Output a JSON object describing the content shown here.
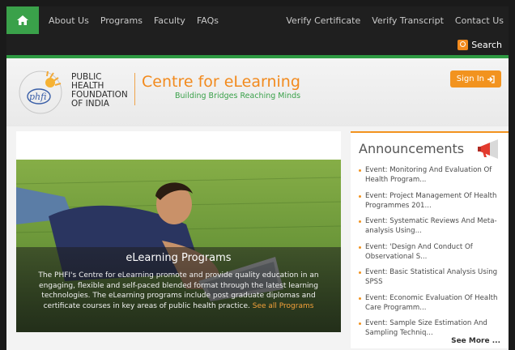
{
  "nav": {
    "links_left": [
      "About Us",
      "Programs",
      "Faculty",
      "FAQs"
    ],
    "links_right": [
      "Verify Certificate",
      "Verify Transcript",
      "Contact Us"
    ],
    "search_label": "Search"
  },
  "header": {
    "org_name_lines": [
      "PUBLIC",
      "HEALTH",
      "FOUNDATION",
      "OF INDIA"
    ],
    "logo_text": "phfi",
    "title": "Centre for eLearning",
    "tagline": "Building Bridges Reaching Minds",
    "signin_label": "Sign In"
  },
  "hero": {
    "title": "eLearning Programs",
    "body": "The PHFI's Centre for eLearning promote and provide quality education in an engaging, flexible and self-paced blended format through the latest learning technologies. The eLearning programs include post graduate diplomas and certificate courses in key areas of public health practice.",
    "link_label": "See all Programs"
  },
  "announcements": {
    "title": "Announcements",
    "items": [
      "Event: Monitoring And Evaluation Of Health Program...",
      "Event: Project Management Of Health Programmes 201...",
      "Event: Systematic Reviews And Meta-analysis Using...",
      "Event: 'Design And Conduct Of Observational S...",
      "Event: Basic Statistical Analysis Using SPSS",
      "Event: Economic Evaluation Of Health Care Programm...",
      "Event: Sample Size Estimation And Sampling Techniq..."
    ],
    "see_more": "See More ..."
  },
  "colors": {
    "brand_orange": "#f2931f",
    "brand_green": "#3aa14a",
    "nav_bg": "#1f1f1f"
  }
}
